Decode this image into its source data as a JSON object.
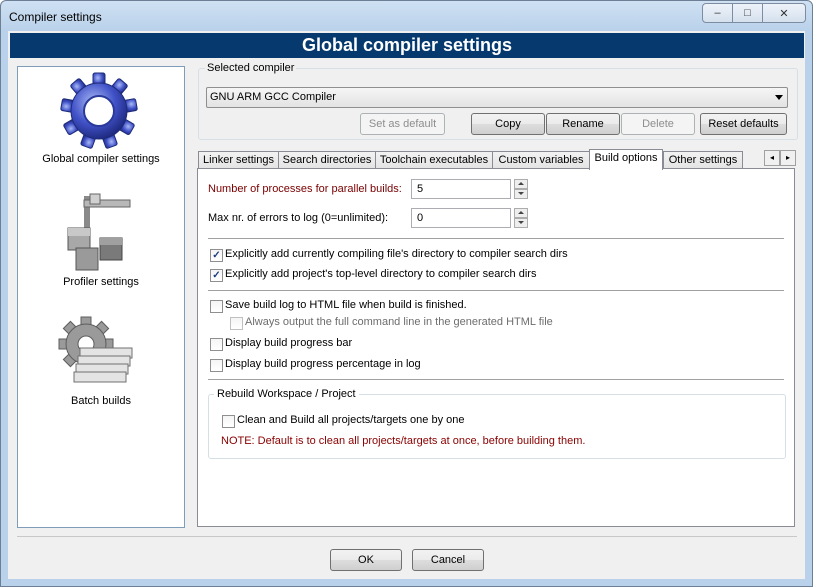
{
  "window": {
    "title": "Compiler settings",
    "caption": {
      "minimize": "–",
      "maximize": "□",
      "close": "✕"
    }
  },
  "banner": {
    "title": "Global compiler settings"
  },
  "sidebar": {
    "items": [
      {
        "label": "Global compiler settings",
        "icon": "gear-icon"
      },
      {
        "label": "Profiler settings",
        "icon": "profiler-icon"
      },
      {
        "label": "Batch builds",
        "icon": "batch-builds-icon"
      }
    ]
  },
  "compiler": {
    "group_label": "Selected compiler",
    "selected": "GNU ARM GCC Compiler",
    "buttons": {
      "set_default": "Set as default",
      "copy": "Copy",
      "rename": "Rename",
      "delete": "Delete",
      "reset": "Reset defaults"
    }
  },
  "tabs": [
    {
      "label": "Linker settings"
    },
    {
      "label": "Search directories"
    },
    {
      "label": "Toolchain executables"
    },
    {
      "label": "Custom variables"
    },
    {
      "label": "Build options"
    },
    {
      "label": "Other settings"
    }
  ],
  "tab_scroll": {
    "left": "◂",
    "right": "▸"
  },
  "build_options": {
    "parallel_label": "Number of processes for parallel builds:",
    "parallel_value": "5",
    "max_errors_label": "Max nr. of errors to log (0=unlimited):",
    "max_errors_value": "0",
    "checkboxes": [
      {
        "label": "Explicitly add currently compiling file's directory to compiler search dirs",
        "checked": true
      },
      {
        "label": "Explicitly add project's top-level directory to compiler search dirs",
        "checked": true
      },
      {
        "label": "Save build log to HTML file when build is finished.",
        "checked": false
      },
      {
        "label": "Always output the full command line in the generated HTML file",
        "checked": false,
        "disabled": true
      },
      {
        "label": "Display build progress bar",
        "checked": false
      },
      {
        "label": "Display build progress percentage in log",
        "checked": false
      }
    ],
    "rebuild_group": {
      "label": "Rebuild Workspace / Project",
      "checkbox": {
        "label": "Clean and Build all projects/targets one by one",
        "checked": false
      },
      "note": "NOTE: Default is to clean all projects/targets at once, before building them."
    },
    "check_mark": "✓"
  },
  "dialog_buttons": {
    "ok": "OK",
    "cancel": "Cancel"
  }
}
